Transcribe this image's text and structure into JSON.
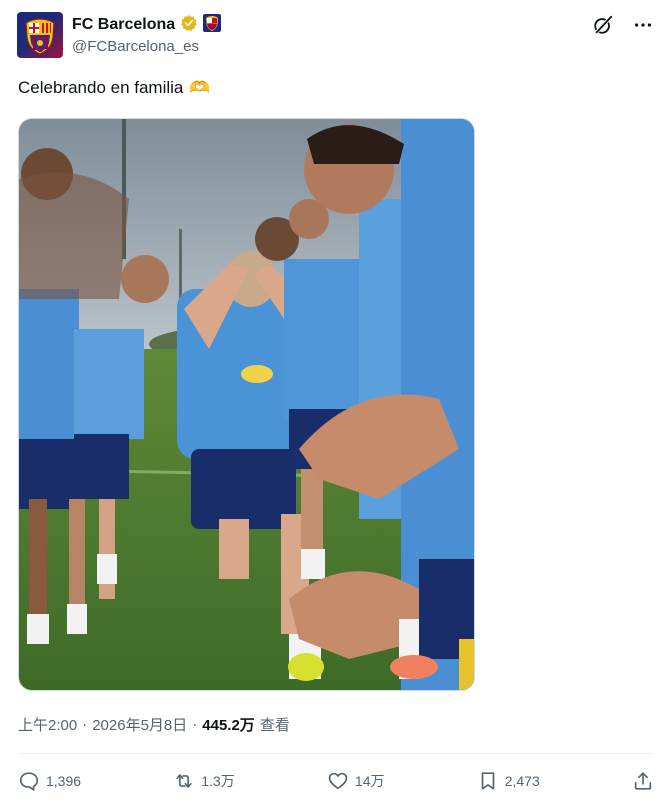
{
  "author": {
    "display_name": "FC Barcelona",
    "handle": "@FCBarcelona_es",
    "avatar_icon": "club-crest-icon",
    "verified_icon": "gold-verified-badge-icon",
    "affiliate_icon": "club-flag-badge-icon"
  },
  "tweet": {
    "text": "Celebrando en familia",
    "emoji": "🫶"
  },
  "meta": {
    "time": "上午2:00",
    "separator1": "·",
    "date": "2026年5月8日",
    "separator2": "·",
    "views": "445.2万",
    "views_label": "查看"
  },
  "actions": {
    "replies": "1,396",
    "reposts": "1.3万",
    "likes": "14万",
    "bookmarks": "2,473"
  },
  "colors": {
    "accent_gold": "#e2b719",
    "text_primary": "#0f1419",
    "text_secondary": "#536471",
    "kit_blue": "#4a8fd4",
    "kit_navy": "#1a2d6b"
  }
}
